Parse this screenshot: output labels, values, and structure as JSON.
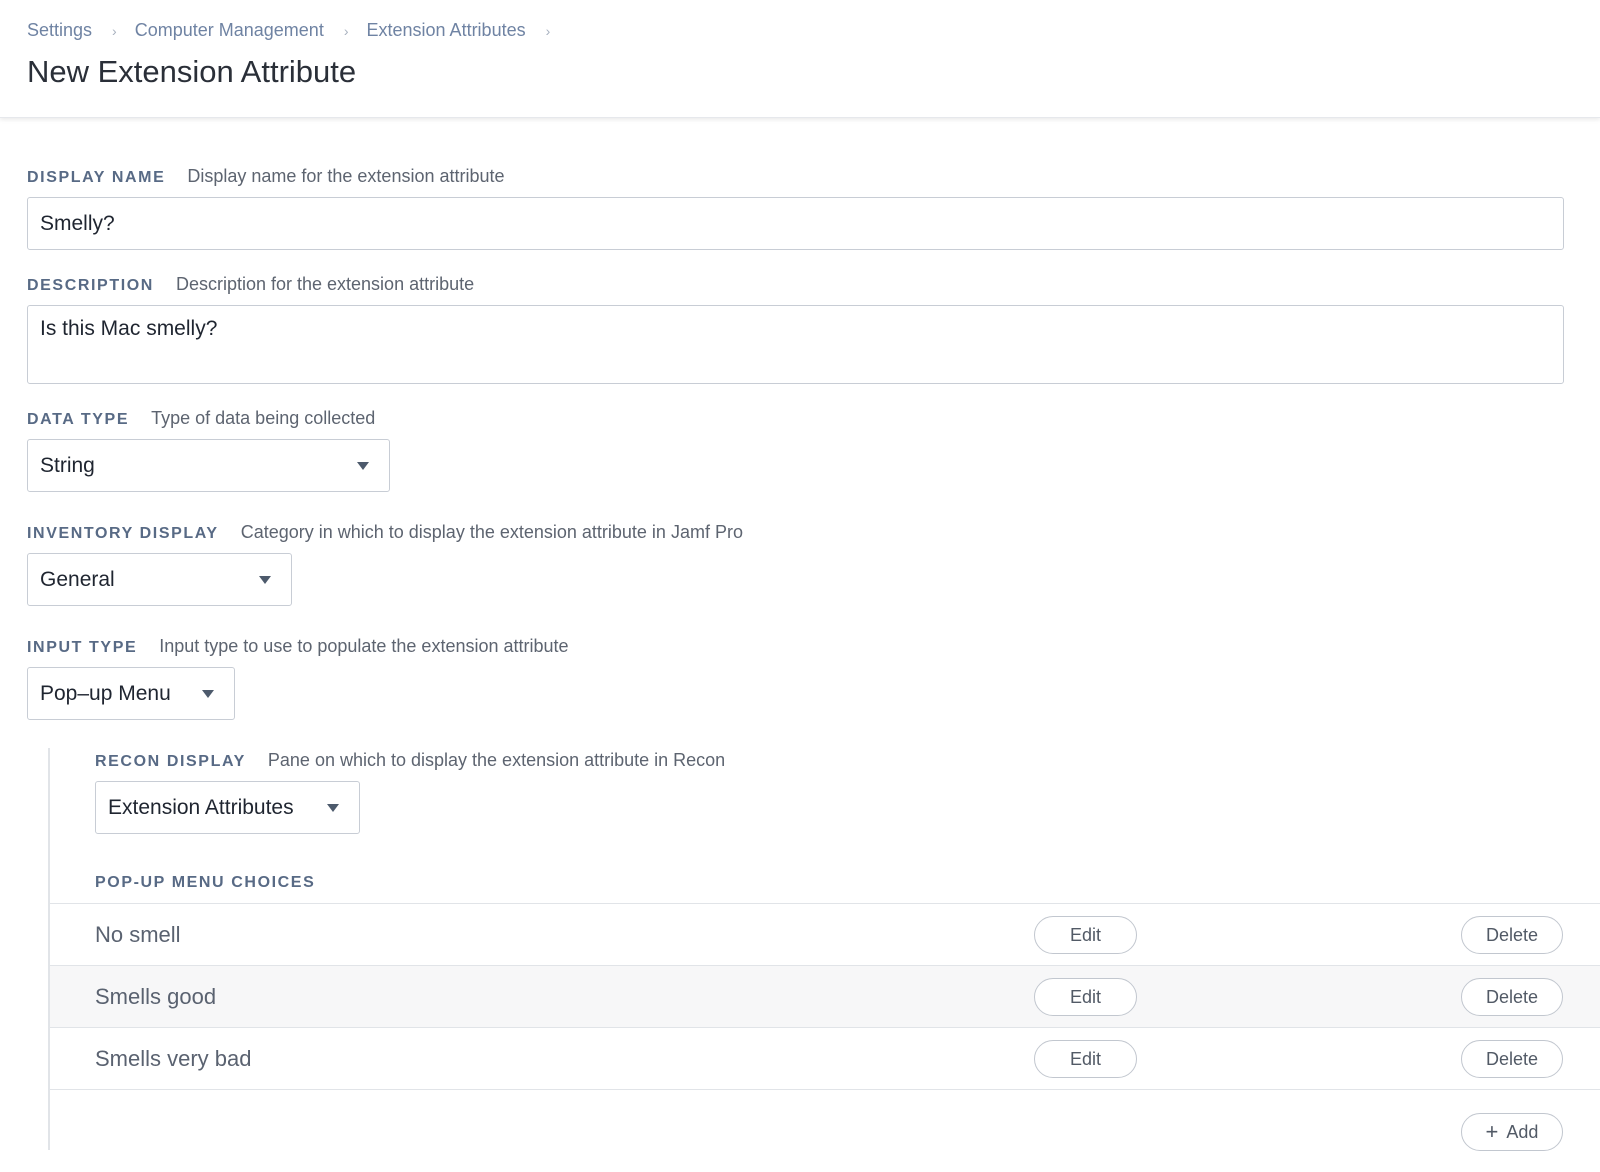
{
  "breadcrumb": {
    "items": [
      "Settings",
      "Computer Management",
      "Extension Attributes"
    ],
    "separator": "›"
  },
  "page": {
    "title": "New Extension Attribute"
  },
  "display_name": {
    "label": "DISPLAY NAME",
    "hint": "Display name for the extension attribute",
    "value": "Smelly?"
  },
  "description": {
    "label": "DESCRIPTION",
    "hint": "Description for the extension attribute",
    "value": "Is this Mac smelly?"
  },
  "data_type": {
    "label": "DATA TYPE",
    "hint": "Type of data being collected",
    "selected": "String"
  },
  "inventory_display": {
    "label": "INVENTORY DISPLAY",
    "hint": "Category in which to display the extension attribute in Jamf Pro",
    "selected": "General"
  },
  "input_type": {
    "label": "INPUT TYPE",
    "hint": "Input type to use to populate the extension attribute",
    "selected": "Pop–up Menu"
  },
  "recon_display": {
    "label": "RECON DISPLAY",
    "hint": "Pane on which to display the extension attribute in Recon",
    "selected": "Extension Attributes"
  },
  "popup_choices": {
    "label": "POP-UP MENU CHOICES",
    "edit_label": "Edit",
    "delete_label": "Delete",
    "add_label": "Add",
    "items": [
      {
        "label": "No smell"
      },
      {
        "label": "Smells good"
      },
      {
        "label": "Smells very bad"
      }
    ]
  }
}
